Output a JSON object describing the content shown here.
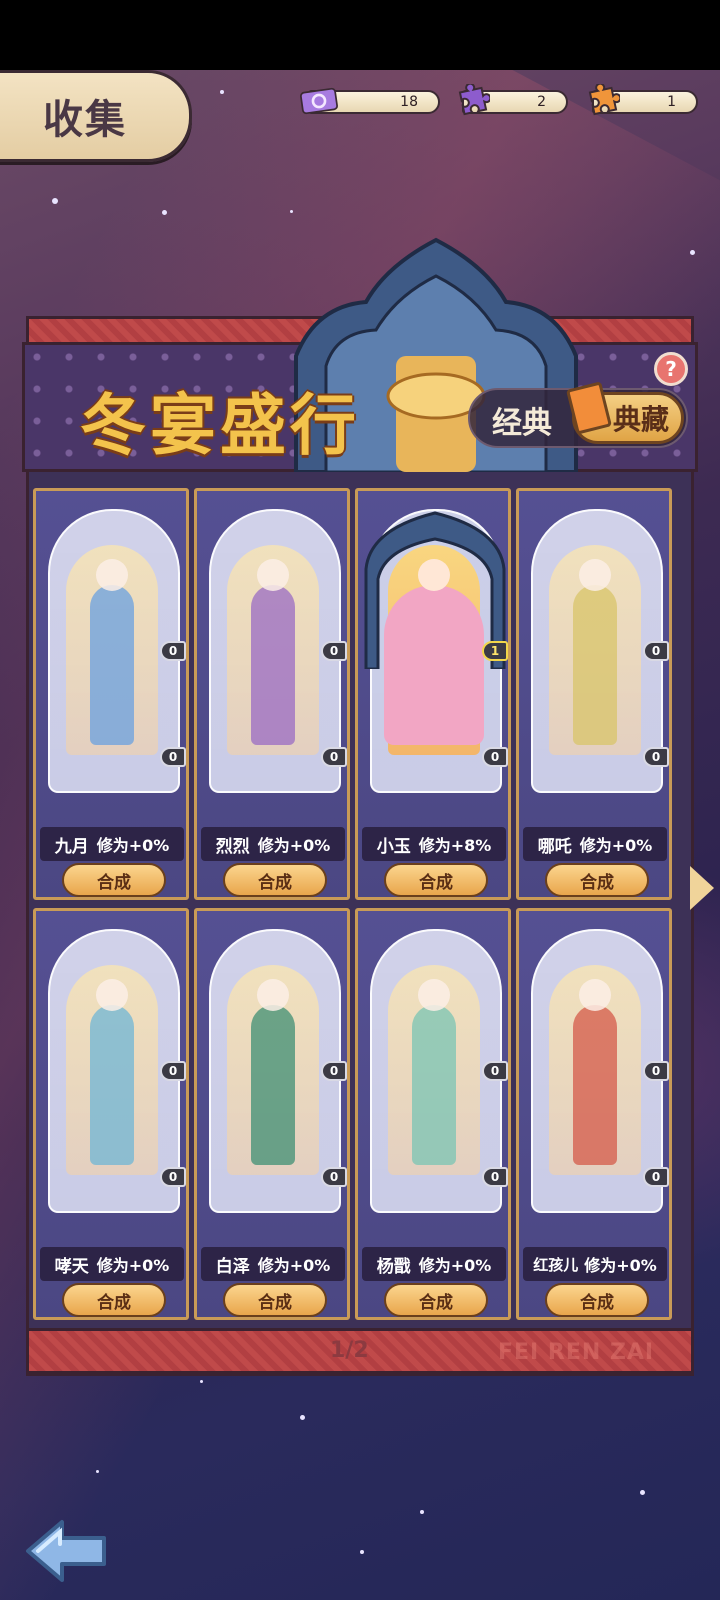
{
  "header": {
    "title": "收集",
    "resources": [
      {
        "icon": "ticket-icon",
        "value": "18",
        "color": "#9b6fd6"
      },
      {
        "icon": "purple-puzzle-icon",
        "value": "2",
        "color": "#8b5cc9"
      },
      {
        "icon": "orange-puzzle-icon",
        "value": "1",
        "color": "#f0953a"
      }
    ]
  },
  "banner": {
    "title": "冬宴盛行",
    "mode_classic": "经典",
    "mode_collection": "典藏",
    "help": "?"
  },
  "cards": [
    {
      "name": "九月",
      "bonus": "修为+0%",
      "count_top": "0",
      "count_bottom": "0",
      "button": "合成",
      "color": "#6aa0e0",
      "unlocked": false
    },
    {
      "name": "烈烈",
      "bonus": "修为+0%",
      "count_top": "0",
      "count_bottom": "0",
      "button": "合成",
      "color": "#9a6bc4",
      "unlocked": false
    },
    {
      "name": "小玉",
      "bonus": "修为+8%",
      "count_top": "1",
      "count_bottom": "0",
      "button": "合成",
      "color": "#f2a6c4",
      "unlocked": true
    },
    {
      "name": "哪吒",
      "bonus": "修为+0%",
      "count_top": "0",
      "count_bottom": "0",
      "button": "合成",
      "color": "#d8c46a",
      "unlocked": false
    },
    {
      "name": "哮天",
      "bonus": "修为+0%",
      "count_top": "0",
      "count_bottom": "0",
      "button": "合成",
      "color": "#6fb6d6",
      "unlocked": false
    },
    {
      "name": "白泽",
      "bonus": "修为+0%",
      "count_top": "0",
      "count_bottom": "0",
      "button": "合成",
      "color": "#3f8f74",
      "unlocked": false
    },
    {
      "name": "杨戬",
      "bonus": "修为+0%",
      "count_top": "0",
      "count_bottom": "0",
      "button": "合成",
      "color": "#7ac4b4",
      "unlocked": false
    },
    {
      "name": "红孩儿",
      "bonus": "修为+0%",
      "count_top": "0",
      "count_bottom": "0",
      "button": "合成",
      "color": "#d45a4a",
      "unlocked": false
    }
  ],
  "pagination": {
    "page": "1/2"
  },
  "watermark": "FEI REN ZAI",
  "nav": {
    "back": "back-arrow-icon",
    "next": "next-arrow-icon"
  }
}
